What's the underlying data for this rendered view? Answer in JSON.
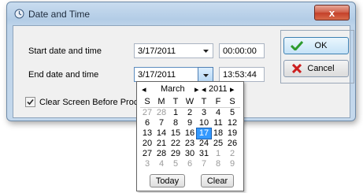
{
  "window": {
    "title": "Date and Time",
    "close_label": "x"
  },
  "form": {
    "start_label": "Start date and time",
    "start_date": "3/17/2011",
    "start_time": "00:00:00",
    "end_label": "End date and time",
    "end_date": "3/17/2011",
    "end_time": "13:53:44",
    "clear_label": "Clear Screen Before Proce",
    "clear_checked": true
  },
  "buttons": {
    "ok": "OK",
    "cancel": "Cancel"
  },
  "calendar": {
    "month": "March",
    "year": "2011",
    "weekdays": [
      "S",
      "M",
      "T",
      "W",
      "T",
      "F",
      "S"
    ],
    "days": [
      {
        "d": "27",
        "o": true
      },
      {
        "d": "28",
        "o": true
      },
      {
        "d": "1"
      },
      {
        "d": "2"
      },
      {
        "d": "3"
      },
      {
        "d": "4"
      },
      {
        "d": "5"
      },
      {
        "d": "6"
      },
      {
        "d": "7"
      },
      {
        "d": "8"
      },
      {
        "d": "9"
      },
      {
        "d": "10"
      },
      {
        "d": "11"
      },
      {
        "d": "12"
      },
      {
        "d": "13"
      },
      {
        "d": "14"
      },
      {
        "d": "15"
      },
      {
        "d": "16"
      },
      {
        "d": "17",
        "s": true
      },
      {
        "d": "18"
      },
      {
        "d": "19"
      },
      {
        "d": "20"
      },
      {
        "d": "21"
      },
      {
        "d": "22"
      },
      {
        "d": "23"
      },
      {
        "d": "24"
      },
      {
        "d": "25"
      },
      {
        "d": "26"
      },
      {
        "d": "27"
      },
      {
        "d": "28"
      },
      {
        "d": "29"
      },
      {
        "d": "30"
      },
      {
        "d": "31"
      },
      {
        "d": "1",
        "o": true
      },
      {
        "d": "2",
        "o": true
      },
      {
        "d": "3",
        "o": true
      },
      {
        "d": "4",
        "o": true
      },
      {
        "d": "5",
        "o": true
      },
      {
        "d": "6",
        "o": true
      },
      {
        "d": "7",
        "o": true
      },
      {
        "d": "8",
        "o": true
      },
      {
        "d": "9",
        "o": true
      }
    ],
    "today_label": "Today",
    "clear_label": "Clear"
  },
  "colors": {
    "accent": "#3399ff",
    "ok_check": "#2e9b2e",
    "cancel_x": "#cc1f1f"
  }
}
